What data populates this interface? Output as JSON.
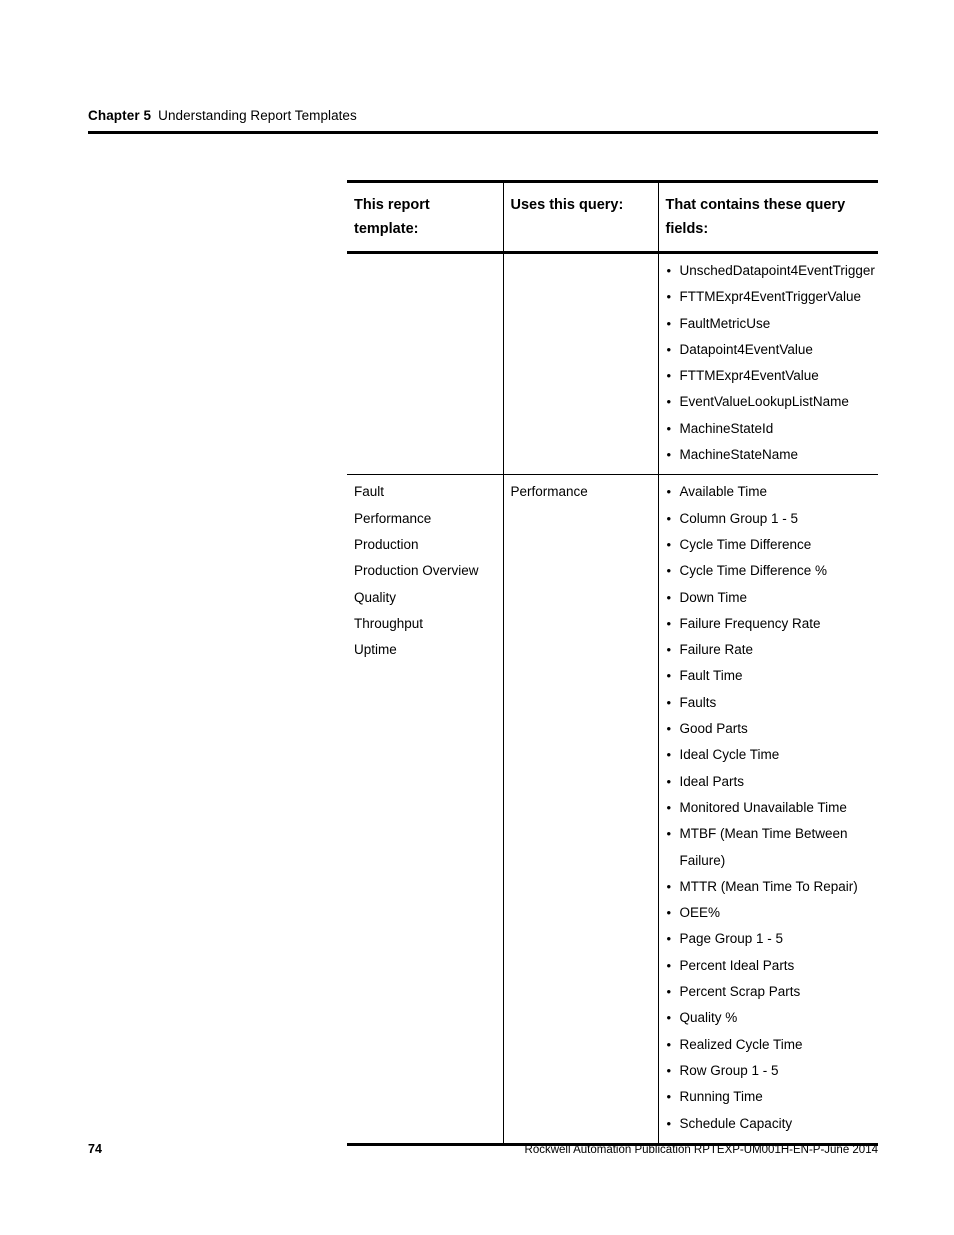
{
  "page": {
    "chapter_label": "Chapter 5",
    "chapter_title": "Understanding Report Templates",
    "page_number": "74",
    "publication": "Rockwell Automation Publication RPTEXP-UM001H-EN-P-June 2014"
  },
  "table": {
    "headers": {
      "col1_line1": "This report",
      "col1_line2": "template:",
      "col2": "Uses this query:",
      "col3_line1": "That contains these query",
      "col3_line2": "fields:"
    },
    "rows": [
      {
        "templates": [],
        "query": "",
        "fields": [
          "UnschedDatapoint4EventTrigger",
          "FTTMExpr4EventTriggerValue",
          "FaultMetricUse",
          "Datapoint4EventValue",
          "FTTMExpr4EventValue",
          "EventValueLookupListName",
          "MachineStateId",
          "MachineStateName"
        ]
      },
      {
        "templates": [
          "Fault",
          "Performance",
          "Production",
          "Production Overview",
          "Quality",
          "Throughput",
          "Uptime"
        ],
        "query": "Performance",
        "fields": [
          "Available Time",
          "Column Group 1 - 5",
          "Cycle Time Difference",
          "Cycle Time Difference %",
          "Down Time",
          "Failure Frequency Rate",
          "Failure Rate",
          "Fault Time",
          "Faults",
          "Good Parts",
          "Ideal Cycle Time",
          "Ideal Parts",
          "Monitored Unavailable Time",
          "MTBF (Mean Time Between Failure)",
          "MTTR (Mean Time To Repair)",
          "OEE%",
          "Page Group 1 - 5",
          "Percent Ideal Parts",
          "Percent Scrap Parts",
          "Quality %",
          "Realized Cycle Time",
          "Row Group 1 - 5",
          "Running Time",
          "Schedule Capacity"
        ]
      }
    ]
  }
}
